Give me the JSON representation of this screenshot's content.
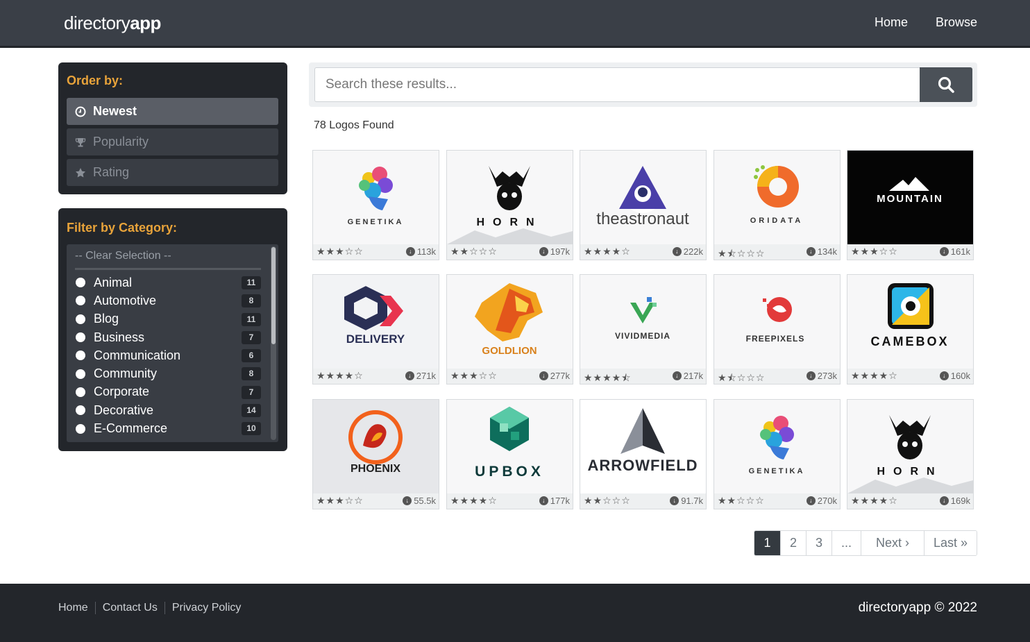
{
  "header": {
    "brand_light": "directory",
    "brand_bold": "app",
    "nav": [
      "Home",
      "Browse"
    ]
  },
  "order": {
    "title": "Order by:",
    "options": [
      {
        "label": "Newest",
        "icon": "clock-icon",
        "active": true
      },
      {
        "label": "Popularity",
        "icon": "trophy-icon",
        "active": false
      },
      {
        "label": "Rating",
        "icon": "star-icon",
        "active": false
      }
    ]
  },
  "categories": {
    "title": "Filter by Category:",
    "clear": "-- Clear Selection --",
    "items": [
      {
        "label": "Animal",
        "count": "11"
      },
      {
        "label": "Automotive",
        "count": "8"
      },
      {
        "label": "Blog",
        "count": "11"
      },
      {
        "label": "Business",
        "count": "7"
      },
      {
        "label": "Communication",
        "count": "6"
      },
      {
        "label": "Community",
        "count": "8"
      },
      {
        "label": "Corporate",
        "count": "7"
      },
      {
        "label": "Decorative",
        "count": "14"
      },
      {
        "label": "E-Commerce",
        "count": "10"
      }
    ]
  },
  "search": {
    "placeholder": "Search these results..."
  },
  "results": {
    "count_text": "78 Logos Found"
  },
  "logos": [
    {
      "name": "GENETIKA",
      "rating": 3,
      "downloads": "113k",
      "style": "genetika"
    },
    {
      "name": "HORN",
      "rating": 2,
      "downloads": "197k",
      "style": "horn"
    },
    {
      "name": "theastronaut",
      "rating": 4,
      "downloads": "222k",
      "style": "astronaut"
    },
    {
      "name": "ORIDATA",
      "rating": 1.5,
      "downloads": "134k",
      "style": "oridata"
    },
    {
      "name": "MOUNTAIN",
      "rating": 3,
      "downloads": "161k",
      "style": "mountain"
    },
    {
      "name": "DELIVERY",
      "rating": 4,
      "downloads": "271k",
      "style": "delivery"
    },
    {
      "name": "GOLDLION",
      "rating": 3,
      "downloads": "277k",
      "style": "goldlion"
    },
    {
      "name": "VIVIDMEDIA",
      "rating": 4.5,
      "downloads": "217k",
      "style": "vividmedia"
    },
    {
      "name": "FREEPIXELS",
      "rating": 1.5,
      "downloads": "273k",
      "style": "freepixels"
    },
    {
      "name": "CAMEBOX",
      "rating": 4,
      "downloads": "160k",
      "style": "camebox"
    },
    {
      "name": "PHOENIX",
      "rating": 3,
      "downloads": "55.5k",
      "style": "phoenix"
    },
    {
      "name": "UPBOX",
      "rating": 4,
      "downloads": "177k",
      "style": "upbox"
    },
    {
      "name": "ARROWFIELD",
      "rating": 2,
      "downloads": "91.7k",
      "style": "arrowfield"
    },
    {
      "name": "GENETIKA",
      "rating": 2,
      "downloads": "270k",
      "style": "genetika"
    },
    {
      "name": "HORN",
      "rating": 4,
      "downloads": "169k",
      "style": "horn"
    }
  ],
  "pagination": {
    "pages": [
      "1",
      "2",
      "3",
      "...",
      "Next ›",
      "Last »"
    ],
    "active": "1"
  },
  "footer": {
    "links": [
      "Home",
      "Contact Us",
      "Privacy Policy"
    ],
    "copyright": "directoryapp © 2022"
  },
  "colors": {
    "header_bg": "#3a3f47",
    "panel_bg": "#23262b",
    "accent": "#e8a33a"
  }
}
